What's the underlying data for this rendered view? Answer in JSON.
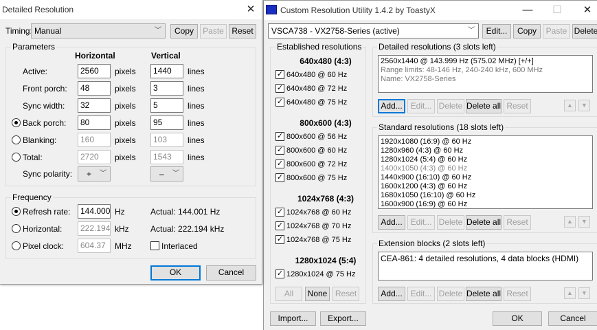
{
  "dr": {
    "title": "Detailed Resolution",
    "close": "✕",
    "timing_label": "Timing:",
    "timing_value": "Manual",
    "copy": "Copy",
    "paste": "Paste",
    "reset": "Reset",
    "parameters": "Parameters",
    "horizontal_hdr": "Horizontal",
    "vertical_hdr": "Vertical",
    "rows": [
      {
        "label": "Active:",
        "h": "2560",
        "hu": "pixels",
        "v": "1440",
        "vu": "lines"
      },
      {
        "label": "Front porch:",
        "h": "48",
        "hu": "pixels",
        "v": "3",
        "vu": "lines"
      },
      {
        "label": "Sync width:",
        "h": "32",
        "hu": "pixels",
        "v": "5",
        "vu": "lines"
      },
      {
        "label": "Back porch:",
        "h": "80",
        "hu": "pixels",
        "v": "95",
        "vu": "lines"
      },
      {
        "label": "Blanking:",
        "h": "160",
        "hu": "pixels",
        "v": "103",
        "vu": "lines"
      },
      {
        "label": "Total:",
        "h": "2720",
        "hu": "pixels",
        "v": "1543",
        "vu": "lines"
      }
    ],
    "sync_label": "Sync polarity:",
    "sync_h": "+",
    "sync_v": "–",
    "frequency": "Frequency",
    "refresh_label": "Refresh rate:",
    "refresh_value": "144.000",
    "refresh_unit": "Hz",
    "refresh_actual": "Actual: 144.001 Hz",
    "horizontal_label": "Horizontal:",
    "horizontal_value": "222.194",
    "horizontal_unit": "kHz",
    "horizontal_actual": "Actual: 222.194 kHz",
    "pixel_label": "Pixel clock:",
    "pixel_value": "604.37",
    "pixel_unit": "MHz",
    "interlaced": "Interlaced",
    "ok": "OK",
    "cancel": "Cancel"
  },
  "cru": {
    "title": "Custom Resolution Utility 1.4.2 by ToastyX",
    "minimize": "—",
    "maximize": "☐",
    "close": "✕",
    "monitor": "VSCA738 - VX2758-Series (active)",
    "edit": "Edit...",
    "copy": "Copy",
    "paste": "Paste",
    "delete": "Delete",
    "established_title": "Established resolutions",
    "established": [
      {
        "header": "640x480 (4:3)",
        "items": [
          "640x480 @ 60 Hz",
          "640x480 @ 72 Hz",
          "640x480 @ 75 Hz"
        ]
      },
      {
        "header": "800x600 (4:3)",
        "items": [
          "800x600 @ 56 Hz",
          "800x600 @ 60 Hz",
          "800x600 @ 72 Hz",
          "800x600 @ 75 Hz"
        ]
      },
      {
        "header": "1024x768 (4:3)",
        "items": [
          "1024x768 @ 60 Hz",
          "1024x768 @ 70 Hz",
          "1024x768 @ 75 Hz"
        ]
      },
      {
        "header": "1280x1024 (5:4)",
        "items": [
          "1280x1024 @ 75 Hz"
        ]
      }
    ],
    "est_all": "All",
    "est_none": "None",
    "est_reset": "Reset",
    "detailed_title": "Detailed resolutions (3 slots left)",
    "detailed_lines": [
      "2560x1440 @ 143.999 Hz (575.02 MHz) [+/+]",
      "Range limits: 48-146 Hz, 240-240 kHz, 600 MHz",
      "Name: VX2758-Series"
    ],
    "standard_title": "Standard resolutions (18 slots left)",
    "standard_lines": [
      "1920x1080 (16:9) @ 60 Hz",
      "1280x960 (4:3) @ 60 Hz",
      "1280x1024 (5:4) @ 60 Hz",
      "1400x1050 (4:3) @ 60 Hz",
      "1440x900 (16:10) @ 60 Hz",
      "1600x1200 (4:3) @ 60 Hz",
      "1680x1050 (16:10) @ 60 Hz",
      "1600x900 (16:9) @ 60 Hz"
    ],
    "extension_title": "Extension blocks (2 slots left)",
    "extension_lines": [
      "CEA-861: 4 detailed resolutions, 4 data blocks (HDMI)"
    ],
    "add": "Add...",
    "edit_btn": "Edit...",
    "del": "Delete",
    "delete_all": "Delete all",
    "reset": "Reset",
    "up": "▲",
    "down": "▼",
    "import": "Import...",
    "export": "Export...",
    "ok": "OK",
    "cancel": "Cancel"
  }
}
